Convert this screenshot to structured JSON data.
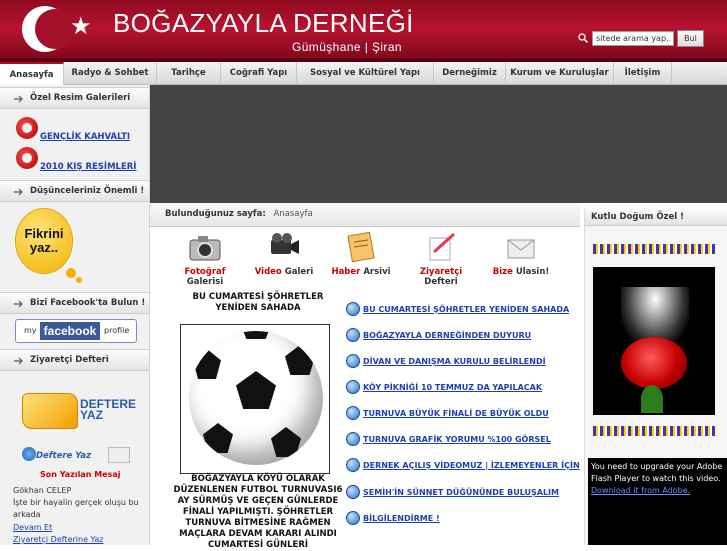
{
  "header": {
    "title": "BOĞAZYAYLA DERNEĞİ",
    "subtitle": "Gümüşhane | Şiran",
    "search_placeholder": "sitede arama yap...",
    "search_button": "Bul",
    "brand_color": "#a4102a"
  },
  "nav": {
    "items": [
      {
        "label": "Anasayfa"
      },
      {
        "label": "Radyo & Sohbet"
      },
      {
        "label": "Tarihçe"
      },
      {
        "label": "Coğrafi Yapı"
      },
      {
        "label": "Sosyal ve Kültürel Yapı"
      },
      {
        "label": "Derneğimiz"
      },
      {
        "label": "Kurum ve Kuruluşlar"
      },
      {
        "label": "İletişim"
      }
    ],
    "active": "Anasayfa"
  },
  "sidebar": {
    "galleries_title": "Özel Resim Galerileri",
    "galleries": [
      {
        "label": "GENÇLİK KAHVALTI"
      },
      {
        "label": "2010 KIŞ RESİMLERİ"
      }
    ],
    "opinions_title": "Düşünceleriniz Önemli !",
    "opinions_badge": "Fikrini yaz..",
    "facebook_title": "Bizi Facebook'ta Bulun !",
    "facebook_badge": {
      "my": "my",
      "brand": "facebook",
      "profile": "profile"
    },
    "guestbook_title": "Ziyaretçi Defteri",
    "guestbook_badge": "DEFTERE YAZ",
    "guestbook_small": "Deftere Yaz",
    "latest_label": "Son Yazılan Mesaj",
    "latest_author": "Gökhan CELEP",
    "latest_text_1": "İşte bir hayalin gerçek oluşu bu",
    "latest_text_2": "arkada",
    "read_more": "Devam Et",
    "write_link": "Ziyaretçi Defterine Yaz"
  },
  "breadcrumb": {
    "label": "Bulunduğunuz sayfa:",
    "value": "Anasayfa"
  },
  "quick_links": [
    {
      "strong": "Fotoğraf",
      "rest": "Galerisi"
    },
    {
      "strong": "Video",
      "rest": "Galeri"
    },
    {
      "strong": "Haber",
      "rest": "Arsivi"
    },
    {
      "strong": "Ziyaretçi",
      "rest": "Defteri"
    },
    {
      "strong": "Bize",
      "rest": "Ulasin!"
    }
  ],
  "featured": {
    "title": "BU CUMARTESİ ŞÖHRETLER YENİDEN SAHADA",
    "body": "BOĞAZYAYLA KÖYÜ OLARAK DÜZENLENEN FUTBOL TURNUVASI6 AY SÜRMÜŞ VE GEÇEN GÜNLERDE FİNALİ YAPILMIŞTI. ŞÖHRETLER TURNUVA BİTMESİNE RAĞMEN MAÇLARA DEVAM KARARI ALINDI CUMARTESİ GÜNLERİ"
  },
  "news": [
    {
      "label": "BU CUMARTESİ ŞÖHRETLER YENİDEN SAHADA"
    },
    {
      "label": "BOĞAZYAYLA DERNEĞİNDEN DUYURU"
    },
    {
      "label": "DİVAN VE DANIŞMA KURULU BELİRLENDİ"
    },
    {
      "label": "KÖY PİKNİĞİ 10 TEMMUZ DA YAPILACAK"
    },
    {
      "label": "TURNUVA BÜYÜK FİNALİ DE BÜYÜK OLDU"
    },
    {
      "label": "TURNUVA GRAFİK YORUMU %100 GÖRSEL"
    },
    {
      "label": "DERNEK AÇILIŞ VİDEOMUZ | İZLEMEYENLER İÇİN"
    },
    {
      "label": "SEMİH'İN SÜNNET DÜĞÜNÜNDE BULUŞALIM"
    },
    {
      "label": "BİLGİLENDİRME !"
    }
  ],
  "right": {
    "title": "Kutlu Doğum Özel !",
    "flash_text": "You need to upgrade your Adobe Flash Player to watch this video.",
    "flash_link": "Download it from Adobe."
  }
}
